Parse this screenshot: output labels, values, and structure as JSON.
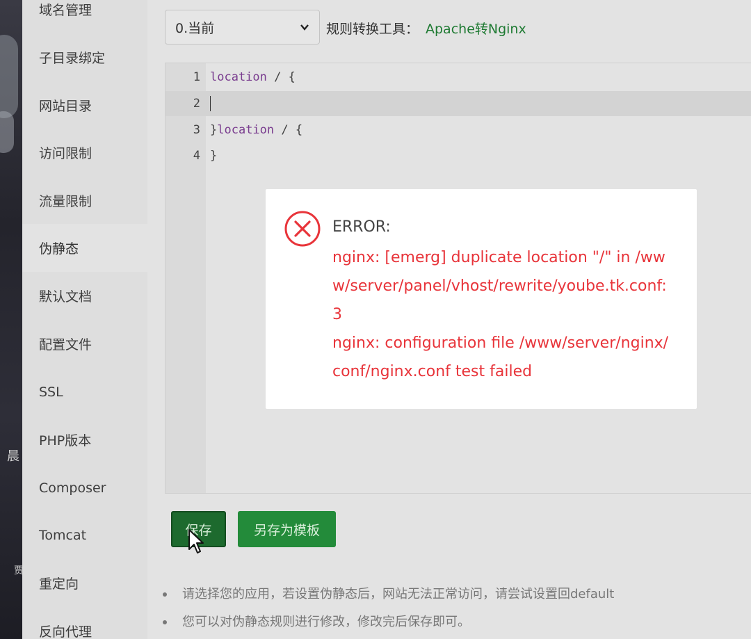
{
  "background_left": {
    "glyph_1": "晨",
    "glyph_2": "贾"
  },
  "sidebar": {
    "items": [
      {
        "label": "域名管理",
        "active": false
      },
      {
        "label": "子目录绑定",
        "active": false
      },
      {
        "label": "网站目录",
        "active": false
      },
      {
        "label": "访问限制",
        "active": false
      },
      {
        "label": "流量限制",
        "active": false
      },
      {
        "label": "伪静态",
        "active": true
      },
      {
        "label": "默认文档",
        "active": false
      },
      {
        "label": "配置文件",
        "active": false
      },
      {
        "label": "SSL",
        "active": false
      },
      {
        "label": "PHP版本",
        "active": false
      },
      {
        "label": "Composer",
        "active": false
      },
      {
        "label": "Tomcat",
        "active": false
      },
      {
        "label": "重定向",
        "active": false
      },
      {
        "label": "反向代理",
        "active": false
      }
    ]
  },
  "toolbar": {
    "select_value": "0.当前",
    "tool_label": "规则转换工具：",
    "tool_link": "Apache转Nginx"
  },
  "editor": {
    "lines": [
      {
        "number": "1",
        "keyword": "location",
        "rest": " / {"
      },
      {
        "number": "2",
        "keyword": "",
        "rest": ""
      },
      {
        "number": "3",
        "prefix": "}",
        "keyword": "location",
        "rest": " / {"
      },
      {
        "number": "4",
        "keyword": "",
        "rest": "}"
      }
    ],
    "active_line": 2
  },
  "buttons": {
    "save_label": "保存",
    "save_template_label": "另存为模板"
  },
  "tips": [
    "请选择您的应用，若设置伪静态后，网站无法正常访问，请尝试设置回default",
    "您可以对伪静态规则进行修改，修改完后保存即可。"
  ],
  "error_dialog": {
    "title": "ERROR:",
    "line_1": "nginx: [emerg] duplicate location \"/\" in /www/server/panel/vhost/rewrite/yoube.tk.conf:3",
    "line_2": "nginx: configuration file /www/server/nginx/conf/nginx.conf test failed"
  },
  "colors": {
    "accent_green": "#238b3a",
    "link_green": "#1e7a32",
    "error_red": "#e8343a"
  }
}
